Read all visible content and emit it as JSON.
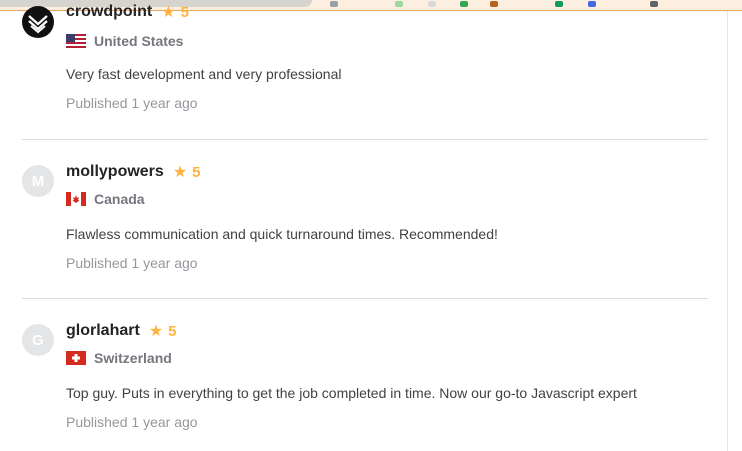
{
  "colors": {
    "star": "#ffb33e",
    "username": "#222325",
    "muted": "#95979d",
    "divider": "#dadbdd",
    "browser_bar": "#fcefe0"
  },
  "reviews": [
    {
      "username": "crowdpoint",
      "avatar_icon": "crowdpoint-logo-icon",
      "rating": "5",
      "country": "United States",
      "flag_icon": "us-flag-icon",
      "text": "Very fast development and very professional",
      "published_label": "Published",
      "published_time": "1 year ago"
    },
    {
      "username": "mollypowers",
      "avatar_initial": "M",
      "rating": "5",
      "country": "Canada",
      "flag_icon": "canada-flag-icon",
      "text": "Flawless communication and quick turnaround times. Recommended!",
      "published_label": "Published",
      "published_time": "1 year ago"
    },
    {
      "username": "glorlahart",
      "avatar_initial": "G",
      "rating": "5",
      "country": "Switzerland",
      "flag_icon": "switzerland-flag-icon",
      "text": "Top guy. Puts in everything to get the job completed in time. Now our go-to Javascript expert",
      "published_label": "Published",
      "published_time": "1 year ago"
    }
  ]
}
